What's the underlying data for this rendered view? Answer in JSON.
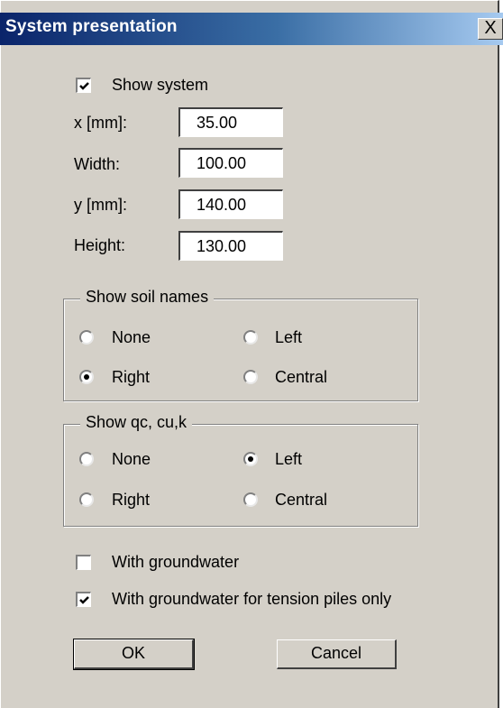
{
  "dialog": {
    "title": "System presentation",
    "close_glyph": "X"
  },
  "show_system": {
    "label": "Show system",
    "checked": true
  },
  "fields": [
    {
      "label": "x [mm]:",
      "value": "35.00"
    },
    {
      "label": "Width:",
      "value": "100.00"
    },
    {
      "label": "y [mm]:",
      "value": "140.00"
    },
    {
      "label": "Height:",
      "value": "130.00"
    }
  ],
  "soil_names": {
    "title": "Show soil names",
    "options": [
      "None",
      "Left",
      "Right",
      "Central"
    ],
    "selected": "Right"
  },
  "qc_cu": {
    "title": "Show qc, cu,k",
    "options": [
      "None",
      "Left",
      "Right",
      "Central"
    ],
    "selected": "Left"
  },
  "groundwater": {
    "label": "With groundwater",
    "checked": false
  },
  "groundwater_tension": {
    "label": "With groundwater for tension piles only",
    "checked": true
  },
  "buttons": {
    "ok": "OK",
    "cancel": "Cancel"
  }
}
